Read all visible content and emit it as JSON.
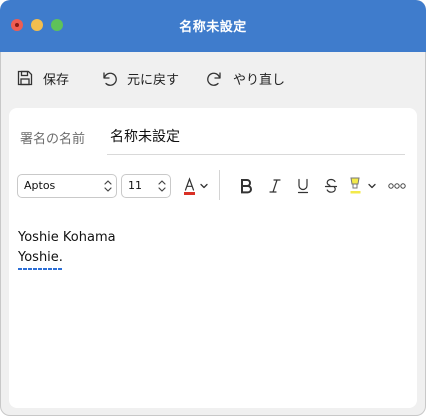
{
  "window": {
    "title": "名称未設定",
    "accent_color": "#3f7ccc"
  },
  "toolbar": {
    "save_label": "保存",
    "undo_label": "元に戻す",
    "redo_label": "やり直し"
  },
  "signature": {
    "name_label": "署名の名前",
    "name_value": "名称未設定"
  },
  "format": {
    "font": "Aptos",
    "size": "11",
    "font_color_icon": "font-color-icon",
    "font_color": "#d93025",
    "highlight_color": "#f3ea4a"
  },
  "editor": {
    "lines": [
      "Yoshie Kohama",
      "Yoshie."
    ]
  }
}
